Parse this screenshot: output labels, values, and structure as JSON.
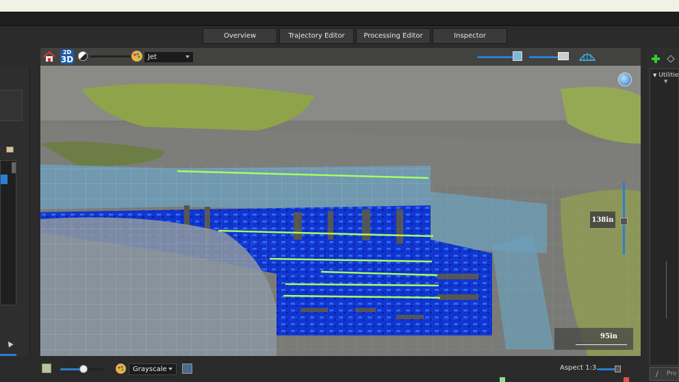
{
  "tabs": [
    {
      "label": "Overview"
    },
    {
      "label": "Trajectory Editor"
    },
    {
      "label": "Processing Editor"
    },
    {
      "label": "Inspector"
    }
  ],
  "viewport": {
    "mode_2d": "2D",
    "mode_3d": "3D",
    "colormap": "Jet",
    "depth_label": "138in",
    "scale_label": "95in"
  },
  "bottom": {
    "colormap": "Grayscale",
    "aspect_label": "Aspect 1:3"
  },
  "right_panel": {
    "tree_label": "Utilitie",
    "bottom_input_placeholder": "Pro"
  },
  "colors": {
    "accent": "#2a7fd4",
    "radar_blue": "#1030c8",
    "utility_line": "#a6ff60"
  }
}
